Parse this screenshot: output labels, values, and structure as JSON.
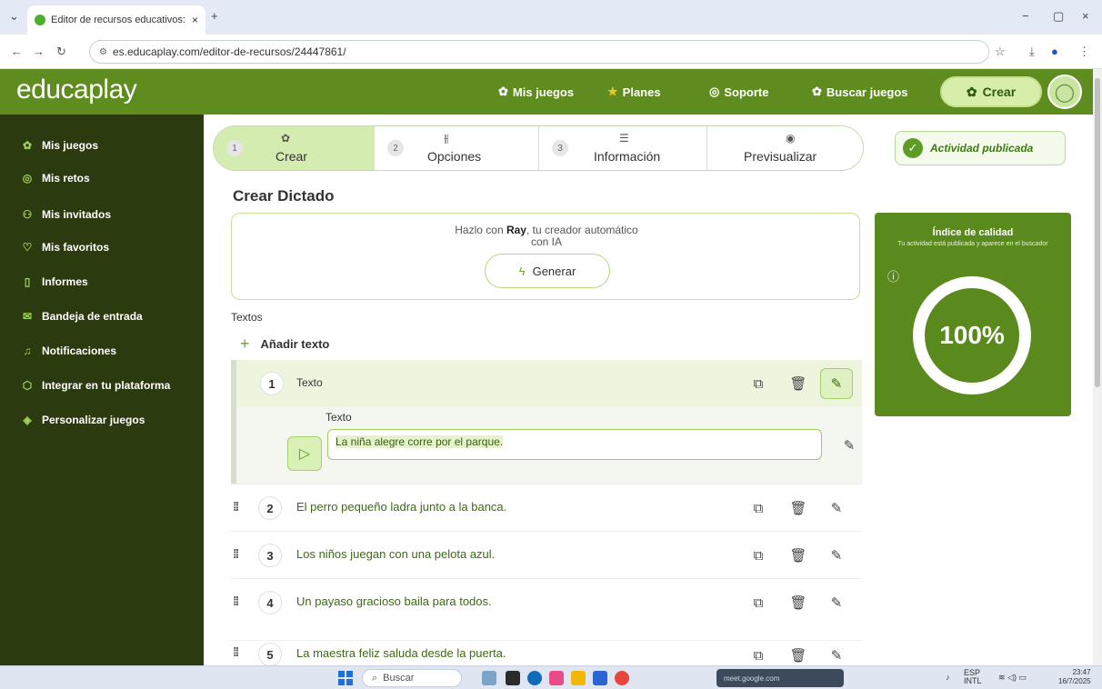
{
  "browser": {
    "tab_title": "Editor de recursos educativos: (",
    "tab_close": "×",
    "new_tab": "+",
    "url": "es.educaplay.com/editor-de-recursos/24447861/",
    "window_controls": [
      "−",
      "▢",
      "×"
    ]
  },
  "header": {
    "logo": "educaplay",
    "nav": [
      {
        "label": "Mis juegos",
        "icon": "puzzle-icon"
      },
      {
        "label": "Planes",
        "icon": "star-icon"
      },
      {
        "label": "Soporte",
        "icon": "support-icon"
      },
      {
        "label": "Buscar juegos",
        "icon": "puzzle-search-icon"
      }
    ],
    "create_label": "Crear"
  },
  "sidebar": {
    "items": [
      {
        "label": "Mis juegos",
        "icon": "puzzle-icon"
      },
      {
        "label": "Mis retos",
        "icon": "target-icon"
      },
      {
        "label": "Mis invitados",
        "icon": "users-icon"
      },
      {
        "label": "Mis favoritos",
        "icon": "heart-icon"
      },
      {
        "label": "Informes",
        "icon": "clipboard-icon"
      },
      {
        "label": "Bandeja de entrada",
        "icon": "mail-icon"
      },
      {
        "label": "Notificaciones",
        "icon": "bell-icon"
      },
      {
        "label": "Integrar en tu plataforma",
        "icon": "cube-icon"
      },
      {
        "label": "Personalizar juegos",
        "icon": "palette-icon"
      }
    ]
  },
  "steps": [
    {
      "num": "1",
      "label": "Crear",
      "icon": "puzzle-icon",
      "active": true
    },
    {
      "num": "2",
      "label": "Opciones",
      "icon": "sliders-icon",
      "active": false
    },
    {
      "num": "3",
      "label": "Información",
      "icon": "list-icon",
      "active": false
    },
    {
      "num": "",
      "label": "Previsualizar",
      "icon": "eye-icon",
      "active": false
    }
  ],
  "status": {
    "published_label": "Actividad publicada"
  },
  "editor": {
    "title": "Crear Dictado",
    "ray_prefix": "Hazlo con ",
    "ray_name": "Ray",
    "ray_suffix": ", tu creador automático",
    "ray_line2": "con IA",
    "generate_label": "Generar",
    "texts_label": "Textos",
    "add_text_label": "Añadir texto",
    "first_item": {
      "num": "1",
      "title": "Texto",
      "field_label": "Texto",
      "value": "La niña alegre corre por el parque."
    },
    "items": [
      {
        "num": "2",
        "text": "El perro pequeño ladra junto a la banca."
      },
      {
        "num": "3",
        "text": "Los niños juegan con una pelota azul."
      },
      {
        "num": "4",
        "text": "Un payaso gracioso baila para todos."
      },
      {
        "num": "5",
        "text": "La maestra feliz saluda desde la puerta."
      }
    ]
  },
  "quality": {
    "title": "Índice de calidad",
    "subtitle": "Tu actividad está publicada y aparece en el buscador",
    "value": "100%",
    "fraction": 1.0
  },
  "taskbar": {
    "search_placeholder": "Buscar",
    "meet_label": "meet.google.com",
    "lang_line1": "ESP",
    "lang_line2": "INTL",
    "time": "23:47",
    "date": "16/7/2025"
  },
  "colors": {
    "brand_green": "#5e8c1e",
    "sidebar_dark": "#2b3a0f",
    "accent_light": "#d4ecb0"
  }
}
